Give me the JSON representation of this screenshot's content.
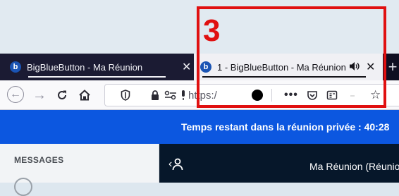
{
  "annotation": {
    "number": "3",
    "color": "#e01010"
  },
  "browser": {
    "tabs": [
      {
        "title": "BigBlueButton - Ma Réunion",
        "favicon": "b",
        "active": false
      },
      {
        "title": "1 - BigBlueButton - Ma Réunion",
        "favicon": "b",
        "active": true
      }
    ],
    "new_tab_icon": "+",
    "url_text": "https:/",
    "flag_colors": [
      "#002395",
      "#ffffff",
      "#ed2939"
    ]
  },
  "notification": {
    "text": "Temps restant dans la réunion privée : 40:28"
  },
  "sidebar": {
    "section_label": "MESSAGES"
  },
  "main": {
    "meeting_title": "Ma Réunion (Réunion)"
  },
  "icons": {
    "back": "back-arrow-icon",
    "forward": "forward-arrow-icon",
    "reload": "reload-icon",
    "home": "home-icon",
    "shield": "tracking-shield-icon",
    "lock": "lock-icon",
    "permissions": "permissions-icon",
    "mic": "microphone-icon",
    "record": "recording-indicator-icon",
    "more": "more-actions-icon",
    "pocket": "pocket-icon",
    "reader": "reader-view-icon",
    "flag": "french-flag-icon",
    "star": "bookmark-star-icon",
    "audio": "speaker-icon",
    "close": "close-icon",
    "users": "users-icon"
  }
}
